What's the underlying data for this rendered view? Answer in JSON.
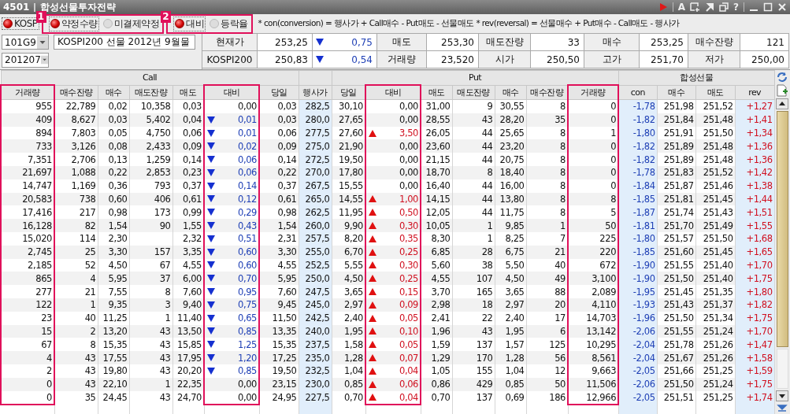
{
  "title_bar": {
    "code": "4501",
    "title": "합성선물투자전략",
    "glyphs": [
      "A",
      "?"
    ]
  },
  "options": {
    "market": {
      "label": "KOSP",
      "selected": true
    },
    "groups": [
      {
        "badge": "1",
        "highlighted": true,
        "items": [
          {
            "label": "약정수량",
            "selected": true
          },
          {
            "label": "미결제약정",
            "selected": false
          }
        ]
      },
      {
        "badge": "2",
        "highlighted": true,
        "items": [
          {
            "label": "대비",
            "selected": true
          },
          {
            "label": "등락율",
            "selected": false
          }
        ]
      }
    ],
    "formula": "* con(conversion) = 행사가 + Call매수 - Put매도 - 선물매도   * rev(reversal) = 선물매수 + Put매수 - Call매도 - 행사가"
  },
  "selectors": [
    {
      "value": "101G9",
      "name": "KOSPI200 선물 2012년  9월물"
    },
    {
      "value": "201207"
    }
  ],
  "quote": [
    {
      "label": "현재가",
      "value": "253,25",
      "change": {
        "kind": "down",
        "value": "0,75"
      },
      "fields": [
        {
          "label": "매도",
          "value": "253,30"
        },
        {
          "label": "매도잔량",
          "value": "33"
        },
        {
          "label": "매수",
          "value": "253,25"
        },
        {
          "label": "매수잔량",
          "value": "121"
        }
      ]
    },
    {
      "label": "KOSPI200",
      "value": "250,83",
      "change": {
        "kind": "down",
        "value": "0,54"
      },
      "fields": [
        {
          "label": "거래량",
          "value": "23,520"
        },
        {
          "label": "시가",
          "value": "250,50"
        },
        {
          "label": "고가",
          "value": "251,70"
        },
        {
          "label": "저가",
          "value": "250,00"
        }
      ]
    }
  ],
  "table": {
    "groups": [
      {
        "label": "Call"
      },
      {
        "label": "Put"
      },
      {
        "label": "합성선물"
      }
    ],
    "columns": [
      {
        "label": "거래량",
        "highlighted": true
      },
      {
        "label": "매수잔량",
        "highlighted": false
      },
      {
        "label": "매수",
        "highlighted": false
      },
      {
        "label": "매도잔량",
        "highlighted": false
      },
      {
        "label": "매도",
        "highlighted": false
      },
      {
        "label": "대비",
        "highlighted": true
      },
      {
        "label": "당일",
        "highlighted": false
      },
      {
        "label": "행사가",
        "highlighted": false
      },
      {
        "label": "당일",
        "highlighted": false
      },
      {
        "label": "대비",
        "highlighted": true
      },
      {
        "label": "매도",
        "highlighted": false
      },
      {
        "label": "매도잔량",
        "highlighted": false
      },
      {
        "label": "매수",
        "highlighted": false
      },
      {
        "label": "매수잔량",
        "highlighted": false
      },
      {
        "label": "거래량",
        "highlighted": true
      },
      {
        "label": "con",
        "highlighted": false
      },
      {
        "label": "매수",
        "highlighted": false
      },
      {
        "label": "매도",
        "highlighted": false
      },
      {
        "label": "rev",
        "highlighted": false
      }
    ],
    "rows": [
      {
        "call": {
          "volume": "955",
          "bid_qty": "22,789",
          "bid": "0,02",
          "ask_qty": "10,358",
          "ask": "0,03"
        },
        "call_change": {
          "kind": "flat",
          "value": "0,00"
        },
        "call_today": "0,03",
        "strike": "282,5",
        "put_today": "30,10",
        "put_change": {
          "kind": "flat",
          "value": "0,00"
        },
        "put": [
          "31,00",
          "9",
          "30,55",
          "8",
          "0"
        ],
        "synthetic": [
          "-1,78",
          "251,98",
          "251,52",
          "+1,27"
        ]
      },
      {
        "call": {
          "volume": "409",
          "bid_qty": "8,627",
          "bid": "0,03",
          "ask_qty": "5,402",
          "ask": "0,04"
        },
        "call_change": {
          "kind": "down",
          "value": "0,01"
        },
        "call_today": "0,03",
        "strike": "280,0",
        "put_today": "27,65",
        "put_change": {
          "kind": "flat",
          "value": "0,00"
        },
        "put": [
          "28,55",
          "43",
          "28,20",
          "35",
          "0"
        ],
        "synthetic": [
          "-1,82",
          "251,84",
          "251,48",
          "+1,41"
        ]
      },
      {
        "call": {
          "volume": "894",
          "bid_qty": "7,803",
          "bid": "0,05",
          "ask_qty": "4,750",
          "ask": "0,06"
        },
        "call_change": {
          "kind": "down",
          "value": "0,01"
        },
        "call_today": "0,06",
        "strike": "277,5",
        "put_today": "27,60",
        "put_change": {
          "kind": "up",
          "value": "3,50"
        },
        "put": [
          "26,05",
          "44",
          "25,65",
          "8",
          "1"
        ],
        "synthetic": [
          "-1,80",
          "251,91",
          "251,50",
          "+1,34"
        ]
      },
      {
        "call": {
          "volume": "733",
          "bid_qty": "3,126",
          "bid": "0,08",
          "ask_qty": "2,433",
          "ask": "0,09"
        },
        "call_change": {
          "kind": "down",
          "value": "0,02"
        },
        "call_today": "0,09",
        "strike": "275,0",
        "put_today": "21,90",
        "put_change": {
          "kind": "flat",
          "value": "0,00"
        },
        "put": [
          "23,60",
          "44",
          "23,20",
          "8",
          "0"
        ],
        "synthetic": [
          "-1,82",
          "251,89",
          "251,48",
          "+1,36"
        ]
      },
      {
        "call": {
          "volume": "7,351",
          "bid_qty": "2,706",
          "bid": "0,13",
          "ask_qty": "1,259",
          "ask": "0,14"
        },
        "call_change": {
          "kind": "down",
          "value": "0,06"
        },
        "call_today": "0,14",
        "strike": "272,5",
        "put_today": "19,50",
        "put_change": {
          "kind": "flat",
          "value": "0,00"
        },
        "put": [
          "21,15",
          "44",
          "20,75",
          "8",
          "0"
        ],
        "synthetic": [
          "-1,82",
          "251,89",
          "251,48",
          "+1,36"
        ]
      },
      {
        "call": {
          "volume": "21,697",
          "bid_qty": "1,088",
          "bid": "0,22",
          "ask_qty": "2,853",
          "ask": "0,23"
        },
        "call_change": {
          "kind": "down",
          "value": "0,06"
        },
        "call_today": "0,22",
        "strike": "270,0",
        "put_today": "17,80",
        "put_change": {
          "kind": "flat",
          "value": "0,00"
        },
        "put": [
          "18,70",
          "8",
          "18,40",
          "8",
          "0"
        ],
        "synthetic": [
          "-1,78",
          "251,83",
          "251,52",
          "+1,42"
        ]
      },
      {
        "call": {
          "volume": "14,747",
          "bid_qty": "1,169",
          "bid": "0,36",
          "ask_qty": "793",
          "ask": "0,37"
        },
        "call_change": {
          "kind": "down",
          "value": "0,14"
        },
        "call_today": "0,37",
        "strike": "267,5",
        "put_today": "15,55",
        "put_change": {
          "kind": "flat",
          "value": "0,00"
        },
        "put": [
          "16,40",
          "44",
          "16,00",
          "8",
          "0"
        ],
        "synthetic": [
          "-1,84",
          "251,87",
          "251,46",
          "+1,38"
        ]
      },
      {
        "call": {
          "volume": "20,583",
          "bid_qty": "738",
          "bid": "0,60",
          "ask_qty": "406",
          "ask": "0,61"
        },
        "call_change": {
          "kind": "down",
          "value": "0,12"
        },
        "call_today": "0,61",
        "strike": "265,0",
        "put_today": "14,55",
        "put_change": {
          "kind": "up",
          "value": "1,00"
        },
        "put": [
          "14,15",
          "44",
          "13,80",
          "8",
          "8"
        ],
        "synthetic": [
          "-1,85",
          "251,81",
          "251,45",
          "+1,44"
        ]
      },
      {
        "call": {
          "volume": "17,416",
          "bid_qty": "217",
          "bid": "0,98",
          "ask_qty": "173",
          "ask": "0,99"
        },
        "call_change": {
          "kind": "down",
          "value": "0,29"
        },
        "call_today": "0,98",
        "strike": "262,5",
        "put_today": "11,95",
        "put_change": {
          "kind": "up",
          "value": "0,50"
        },
        "put": [
          "12,05",
          "44",
          "11,75",
          "8",
          "5"
        ],
        "synthetic": [
          "-1,87",
          "251,74",
          "251,43",
          "+1,51"
        ]
      },
      {
        "call": {
          "volume": "16,128",
          "bid_qty": "82",
          "bid": "1,54",
          "ask_qty": "90",
          "ask": "1,55"
        },
        "call_change": {
          "kind": "down",
          "value": "0,43"
        },
        "call_today": "1,54",
        "strike": "260,0",
        "put_today": "9,90",
        "put_change": {
          "kind": "up",
          "value": "0,30"
        },
        "put": [
          "10,05",
          "1",
          "9,85",
          "1",
          "50"
        ],
        "synthetic": [
          "-1,81",
          "251,70",
          "251,49",
          "+1,55"
        ]
      },
      {
        "call": {
          "volume": "15,020",
          "bid_qty": "114",
          "bid": "2,30",
          "ask": "2,32"
        },
        "call_change": {
          "kind": "down",
          "value": "0,51"
        },
        "call_today": "2,31",
        "strike": "257,5",
        "put_today": "8,20",
        "put_change": {
          "kind": "up",
          "value": "0,35"
        },
        "put": [
          "8,30",
          "1",
          "8,25",
          "7",
          "225"
        ],
        "synthetic": [
          "-1,80",
          "251,57",
          "251,50",
          "+1,68"
        ]
      },
      {
        "call": {
          "volume": "2,745",
          "bid_qty": "25",
          "bid": "3,30",
          "ask_qty": "157",
          "ask": "3,35"
        },
        "call_change": {
          "kind": "down",
          "value": "0,60"
        },
        "call_today": "3,30",
        "strike": "255,0",
        "put_today": "6,70",
        "put_change": {
          "kind": "up",
          "value": "0,25"
        },
        "put": [
          "6,85",
          "28",
          "6,75",
          "21",
          "220"
        ],
        "synthetic": [
          "-1,85",
          "251,60",
          "251,45",
          "+1,65"
        ]
      },
      {
        "call": {
          "volume": "2,185",
          "bid_qty": "52",
          "bid": "4,50",
          "ask_qty": "67",
          "ask": "4,55"
        },
        "call_change": {
          "kind": "down",
          "value": "0,60"
        },
        "call_today": "4,55",
        "strike": "252,5",
        "put_today": "5,55",
        "put_change": {
          "kind": "up",
          "value": "0,30"
        },
        "put": [
          "5,60",
          "38",
          "5,50",
          "40",
          "672"
        ],
        "synthetic": [
          "-1,90",
          "251,55",
          "251,40",
          "+1,70"
        ]
      },
      {
        "call": {
          "volume": "865",
          "bid_qty": "4",
          "bid": "5,95",
          "ask_qty": "37",
          "ask": "6,00"
        },
        "call_change": {
          "kind": "down",
          "value": "0,70"
        },
        "call_today": "5,95",
        "strike": "250,0",
        "put_today": "4,50",
        "put_change": {
          "kind": "up",
          "value": "0,25"
        },
        "put": [
          "4,55",
          "107",
          "4,50",
          "49",
          "3,100"
        ],
        "synthetic": [
          "-1,90",
          "251,50",
          "251,40",
          "+1,75"
        ]
      },
      {
        "call": {
          "volume": "277",
          "bid_qty": "21",
          "bid": "7,55",
          "ask_qty": "8",
          "ask": "7,60"
        },
        "call_change": {
          "kind": "down",
          "value": "0,95"
        },
        "call_today": "7,60",
        "strike": "247,5",
        "put_today": "3,65",
        "put_change": {
          "kind": "up",
          "value": "0,15"
        },
        "put": [
          "3,70",
          "165",
          "3,65",
          "88",
          "2,089"
        ],
        "synthetic": [
          "-1,95",
          "251,45",
          "251,35",
          "+1,80"
        ]
      },
      {
        "call": {
          "volume": "122",
          "bid_qty": "1",
          "bid": "9,35",
          "ask_qty": "3",
          "ask": "9,40"
        },
        "call_change": {
          "kind": "down",
          "value": "0,75"
        },
        "call_today": "9,45",
        "strike": "245,0",
        "put_today": "2,97",
        "put_change": {
          "kind": "up",
          "value": "0,09"
        },
        "put": [
          "2,98",
          "18",
          "2,97",
          "20",
          "4,110"
        ],
        "synthetic": [
          "-1,93",
          "251,43",
          "251,37",
          "+1,82"
        ]
      },
      {
        "call": {
          "volume": "23",
          "bid_qty": "40",
          "bid": "11,25",
          "ask_qty": "1",
          "ask": "11,40"
        },
        "call_change": {
          "kind": "down",
          "value": "0,65"
        },
        "call_today": "11,50",
        "strike": "242,5",
        "put_today": "2,40",
        "put_change": {
          "kind": "up",
          "value": "0,05"
        },
        "put": [
          "2,41",
          "22",
          "2,40",
          "17",
          "14,703"
        ],
        "synthetic": [
          "-1,96",
          "251,50",
          "251,34",
          "+1,75"
        ]
      },
      {
        "call": {
          "volume": "15",
          "bid_qty": "2",
          "bid": "13,20",
          "ask_qty": "43",
          "ask": "13,50"
        },
        "call_change": {
          "kind": "down",
          "value": "0,85"
        },
        "call_today": "13,35",
        "strike": "240,0",
        "put_today": "1,95",
        "put_change": {
          "kind": "up",
          "value": "0,10"
        },
        "put": [
          "1,96",
          "43",
          "1,95",
          "6",
          "13,142"
        ],
        "synthetic": [
          "-2,06",
          "251,55",
          "251,24",
          "+1,70"
        ]
      },
      {
        "call": {
          "volume": "67",
          "bid_qty": "8",
          "bid": "15,35",
          "ask_qty": "43",
          "ask": "15,85"
        },
        "call_change": {
          "kind": "down",
          "value": "1,25"
        },
        "call_today": "15,35",
        "strike": "237,5",
        "put_today": "1,58",
        "put_change": {
          "kind": "up",
          "value": "0,05"
        },
        "put": [
          "1,59",
          "137",
          "1,57",
          "125",
          "10,295"
        ],
        "synthetic": [
          "-2,04",
          "251,78",
          "251,26",
          "+1,47"
        ]
      },
      {
        "call": {
          "volume": "4",
          "bid_qty": "43",
          "bid": "17,55",
          "ask_qty": "43",
          "ask": "17,95"
        },
        "call_change": {
          "kind": "down",
          "value": "1,20"
        },
        "call_today": "17,25",
        "strike": "235,0",
        "put_today": "1,28",
        "put_change": {
          "kind": "up",
          "value": "0,07"
        },
        "put": [
          "1,29",
          "170",
          "1,28",
          "56",
          "8,561"
        ],
        "synthetic": [
          "-2,04",
          "251,67",
          "251,26",
          "+1,58"
        ]
      },
      {
        "call": {
          "volume": "2",
          "bid_qty": "43",
          "bid": "19,80",
          "ask_qty": "43",
          "ask": "20,20"
        },
        "call_change": {
          "kind": "down",
          "value": "0,85"
        },
        "call_today": "19,50",
        "strike": "232,5",
        "put_today": "1,04",
        "put_change": {
          "kind": "up",
          "value": "0,04"
        },
        "put": [
          "1,05",
          "155",
          "1,04",
          "12",
          "9,663"
        ],
        "synthetic": [
          "-2,05",
          "251,66",
          "251,25",
          "+1,59"
        ]
      },
      {
        "call": {
          "volume": "0",
          "bid_qty": "43",
          "bid": "22,10",
          "ask_qty": "1",
          "ask": "22,35"
        },
        "call_change": {
          "kind": "flat",
          "value": "0,00"
        },
        "call_today": "23,15",
        "strike": "230,0",
        "put_today": "0,85",
        "put_change": {
          "kind": "up",
          "value": "0,06"
        },
        "put": [
          "0,86",
          "429",
          "0,85",
          "50",
          "11,506"
        ],
        "synthetic": [
          "-2,06",
          "251,50",
          "251,24",
          "+1,75"
        ]
      },
      {
        "call": {
          "volume": "0",
          "bid_qty": "35",
          "bid": "24,45",
          "ask_qty": "43",
          "ask": "24,70"
        },
        "call_change": {
          "kind": "flat",
          "value": "0,00"
        },
        "call_today": "24,95",
        "strike": "227,5",
        "put_today": "0,70",
        "put_change": {
          "kind": "up",
          "value": "0,04"
        },
        "put": [
          "0,70",
          "137",
          "0,69",
          "186",
          "12,966"
        ],
        "synthetic": [
          "-2,05",
          "251,51",
          "251,25",
          "+1,74"
        ]
      }
    ]
  }
}
